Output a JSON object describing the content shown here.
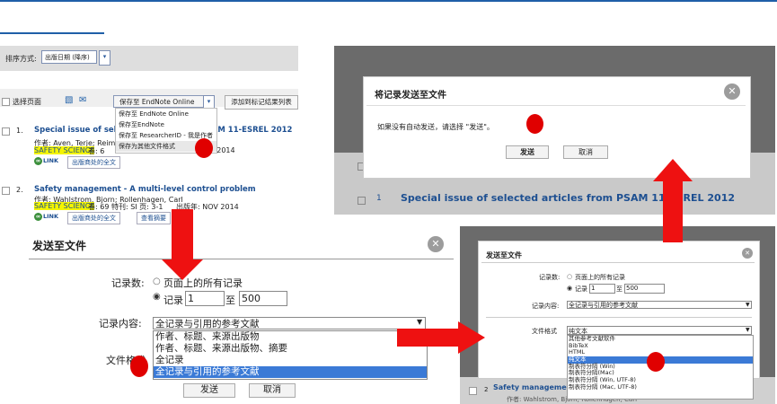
{
  "results": {
    "sort_label": "排序方式:",
    "sort_value": "出版日期 (降序)",
    "select_page": "选择页面",
    "endnote_button": "保存至 EndNote Online",
    "add_to_marked": "添加到标记结果列表",
    "save_menu": [
      "保存至 EndNote Online",
      "保存至EndNote",
      "保存至 ResearcherID - 我是作者",
      "保存为其他文件格式"
    ],
    "records": [
      {
        "num": "1.",
        "title": "Special issue of selected articles from PSAM 11-ESREL 2012",
        "authors": "作者: Aven, Terje; Reiman",
        "journal": "SAFETY SCIENCE",
        "meta": "卷: 6",
        "date": "/ 2014",
        "fulltext": "出版商处的全文"
      },
      {
        "num": "2.",
        "title": "Safety management - A multi-level control problem",
        "authors": "作者: Wahlstrom, Bjorn; Rollenhagen, Carl",
        "journal": "SAFETY SCIENCE",
        "meta": "卷: 69  特刊: SI  页: 3-1",
        "date": "出版年: NOV 2014",
        "fulltext": "出版商处的全文",
        "view_abstract": "查看摘要"
      }
    ],
    "link_icon": "LINK"
  },
  "send_dialog": {
    "title": "将记录发送至文件",
    "message": "如果没有自动发送，请选择 \"发送\"。",
    "send_button": "发送",
    "cancel_button": "取消",
    "bg_title": "Special issue of selected articles from PSAM 11-ESREL 2012",
    "bg_num": "1"
  },
  "big_dialog": {
    "title": "发送至文件",
    "record_count_label": "记录数:",
    "all_records": "页面上的所有记录",
    "records_label": "记录",
    "from": "1",
    "to_label": "至",
    "to": "500",
    "content_label": "记录内容:",
    "content_value": "全记录与引用的参考文献",
    "content_options": [
      "作者、标题、来源出版物",
      "作者、标题、来源出版物、摘要",
      "全记录",
      "全记录与引用的参考文献"
    ],
    "format_label": "文件格式",
    "send_button": "发送",
    "cancel_button": "取消"
  },
  "small_dialog": {
    "title": "发送至文件",
    "record_count_label": "记录数:",
    "all_records": "页面上的所有记录",
    "records_label": "记录",
    "from": "1",
    "to_label": "至",
    "to": "500",
    "content_label": "记录内容:",
    "content_value": "全记录与引用的参考文献",
    "format_label": "文件格式",
    "format_value": "纯文本",
    "format_options": [
      "其他参考文献软件",
      "BibTeX",
      "HTML",
      "纯文本",
      "制表符分隔 (Win)",
      "制表符分隔(Mac)",
      "制表符分隔 (Win, UTF-8)",
      "制表符分隔 (Mac, UTF-8)"
    ],
    "bg_num": "2",
    "bg_title": "Safety manageme",
    "bg_authors": "作者: Wahlstrom, Bjorn; Rollenhagen, Carl"
  },
  "colors": {
    "accent": "#1f5fa8",
    "arrow": "#ee1111",
    "marker": "#e00000",
    "overlay": "#6b6b6b"
  }
}
